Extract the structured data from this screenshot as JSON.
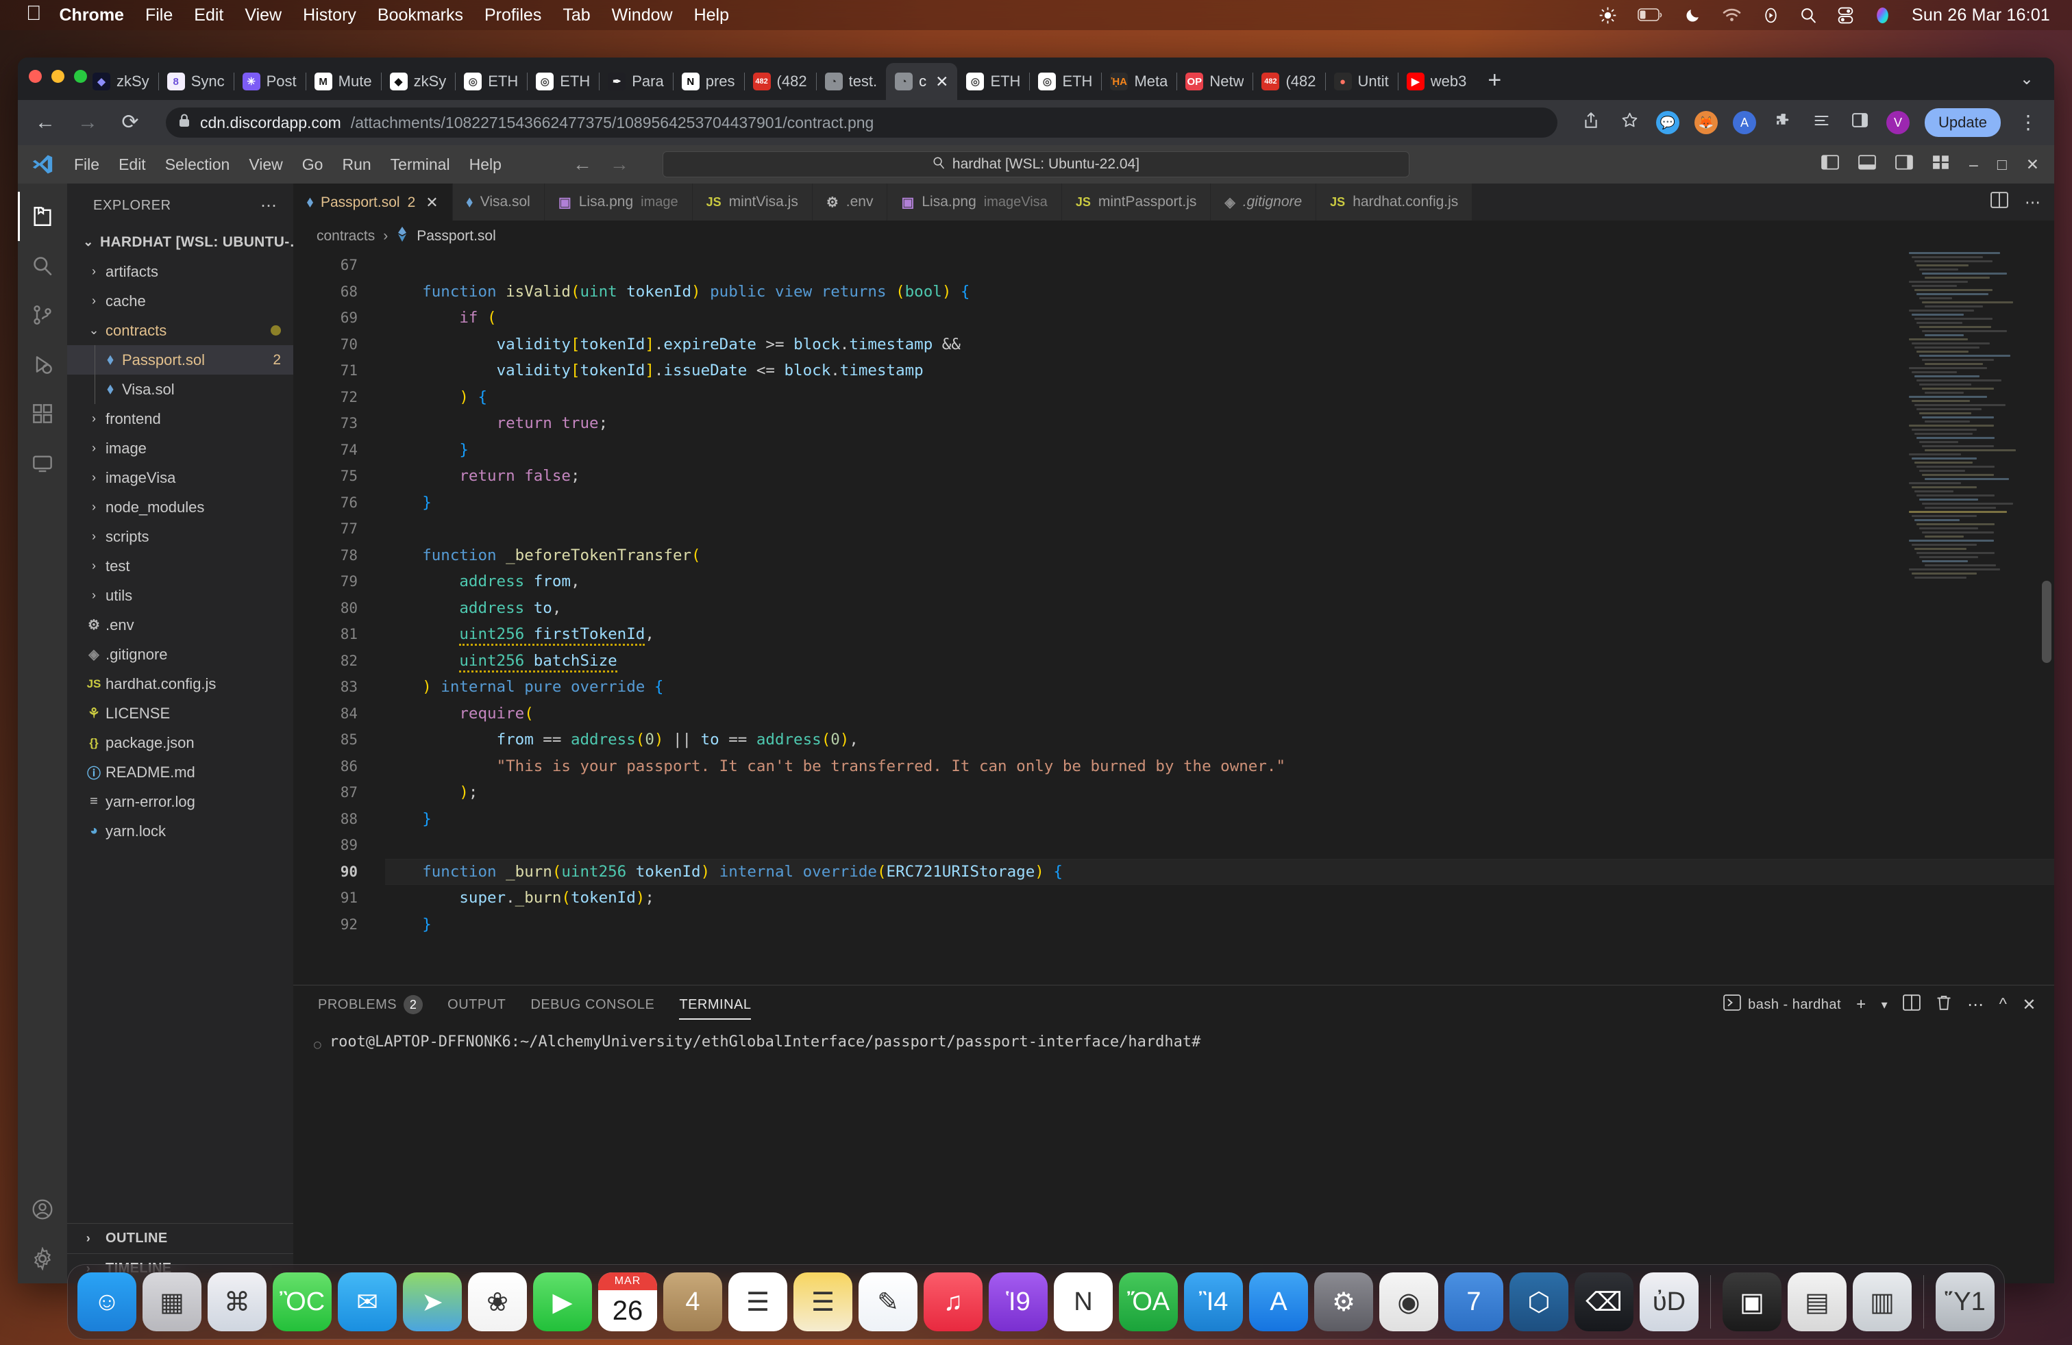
{
  "macos": {
    "apple_icon": "apple-logo",
    "menus": [
      {
        "label": "Chrome",
        "bold": true
      },
      {
        "label": "File",
        "bold": false
      },
      {
        "label": "Edit",
        "bold": false
      },
      {
        "label": "View",
        "bold": false
      },
      {
        "label": "History",
        "bold": false
      },
      {
        "label": "Bookmarks",
        "bold": false
      },
      {
        "label": "Profiles",
        "bold": false
      },
      {
        "label": "Tab",
        "bold": false
      },
      {
        "label": "Window",
        "bold": false
      },
      {
        "label": "Help",
        "bold": false
      }
    ],
    "status_icons": [
      "brightness-icon",
      "battery-icon",
      "moon-do-not-disturb-icon",
      "wifi-icon",
      "now-playing-icon",
      "spotlight-search-icon",
      "control-center-icon",
      "siri-icon"
    ],
    "clock": "Sun 26 Mar  16:01"
  },
  "chrome": {
    "tabs": [
      {
        "title": "zkSy",
        "favicon": "zksync-icon",
        "active": false
      },
      {
        "title": "Sync",
        "favicon": "sync-icon",
        "active": false
      },
      {
        "title": "Post",
        "favicon": "post-icon",
        "active": false
      },
      {
        "title": "Mute",
        "favicon": "mute-icon",
        "active": false
      },
      {
        "title": "zkSy",
        "favicon": "zksync-light-icon",
        "active": false
      },
      {
        "title": "ETH",
        "favicon": "ethglobal-icon",
        "active": false
      },
      {
        "title": "ETH",
        "favicon": "ethglobal-icon",
        "active": false
      },
      {
        "title": "Para",
        "favicon": "paragraph-icon",
        "active": false
      },
      {
        "title": "pres",
        "favicon": "notion-icon",
        "active": false
      },
      {
        "title": "(482",
        "favicon": "gmail-482-icon",
        "active": false
      },
      {
        "title": "test.",
        "favicon": "globe-icon",
        "active": false
      },
      {
        "title": "c",
        "favicon": "globe-icon",
        "active": true
      },
      {
        "title": "ETH",
        "favicon": "ethglobal-icon",
        "active": false
      },
      {
        "title": "ETH",
        "favicon": "ethglobal-icon",
        "active": false
      },
      {
        "title": "Meta",
        "favicon": "metamask-icon",
        "active": false
      },
      {
        "title": "Netw",
        "favicon": "optimism-icon",
        "active": false
      },
      {
        "title": "(482",
        "favicon": "gmail-482-icon",
        "active": false
      },
      {
        "title": "Untit",
        "favicon": "figma-icon",
        "active": false
      },
      {
        "title": "web3",
        "favicon": "youtube-icon",
        "active": false
      }
    ],
    "new_tab_label": "+",
    "tab_list_chevron": "⌄",
    "toolbar": {
      "back": "←",
      "forward": "→",
      "reload": "⟳",
      "lock_icon": "lock-icon",
      "url_host": "cdn.discordapp.com",
      "url_path": "/attachments/1082271543662477375/1089564253704437901/contract.png",
      "share_icon": "share-icon",
      "bookmark_icon": "star-icon",
      "extensions": [
        "chat-extension-icon",
        "metamask-extension-icon",
        "aleph-extension-icon",
        "puzzle-extension-icon",
        "reading-list-icon",
        "sidepanel-icon"
      ],
      "profile_initial": "V",
      "update_label": "Update",
      "menu_icon": "kebab-menu-icon"
    }
  },
  "vscode": {
    "titlebar": {
      "logo": "vscode-logo",
      "menus": [
        "File",
        "Edit",
        "Selection",
        "View",
        "Go",
        "Run",
        "Terminal",
        "Help"
      ],
      "back_arrow": "←",
      "forward_arrow": "→",
      "search_icon": "magnifier-icon",
      "search_text": "hardhat [WSL: Ubuntu-22.04]",
      "right_icons": [
        "toggle-primary-sidebar-icon",
        "toggle-panel-icon",
        "toggle-secondary-sidebar-icon",
        "customize-layout-icon"
      ],
      "window_controls": [
        "minimize",
        "maximize",
        "close"
      ]
    },
    "activitybar": [
      {
        "name": "explorer",
        "icon": "files-icon",
        "active": true
      },
      {
        "name": "search",
        "icon": "search-icon",
        "active": false
      },
      {
        "name": "source-control",
        "icon": "source-control-icon",
        "active": false
      },
      {
        "name": "run-and-debug",
        "icon": "debug-icon",
        "active": false
      },
      {
        "name": "extensions",
        "icon": "extensions-icon",
        "active": false
      },
      {
        "name": "remote-explorer",
        "icon": "remote-icon",
        "active": false
      },
      {
        "name": "accounts",
        "icon": "account-icon",
        "active": false
      },
      {
        "name": "settings",
        "icon": "gear-icon",
        "active": false
      }
    ],
    "explorer": {
      "header": "EXPLORER",
      "more_actions": "⋯",
      "root": "HARDHAT [WSL: UBUNTU-…",
      "tree": [
        {
          "label": "artifacts",
          "type": "folder",
          "expanded": false,
          "indent": 1
        },
        {
          "label": "cache",
          "type": "folder",
          "expanded": false,
          "indent": 1
        },
        {
          "label": "contracts",
          "type": "folder",
          "expanded": true,
          "indent": 1,
          "modified": true,
          "dot": true
        },
        {
          "label": "Passport.sol",
          "type": "solidity",
          "indent": 2,
          "selected": true,
          "modified": true,
          "count": "2"
        },
        {
          "label": "Visa.sol",
          "type": "solidity",
          "indent": 2
        },
        {
          "label": "frontend",
          "type": "folder",
          "expanded": false,
          "indent": 1
        },
        {
          "label": "image",
          "type": "folder",
          "expanded": false,
          "indent": 1
        },
        {
          "label": "imageVisa",
          "type": "folder",
          "expanded": false,
          "indent": 1
        },
        {
          "label": "node_modules",
          "type": "folder",
          "expanded": false,
          "indent": 1
        },
        {
          "label": "scripts",
          "type": "folder",
          "expanded": false,
          "indent": 1
        },
        {
          "label": "test",
          "type": "folder",
          "expanded": false,
          "indent": 1
        },
        {
          "label": "utils",
          "type": "folder",
          "expanded": false,
          "indent": 1
        },
        {
          "label": ".env",
          "type": "env",
          "indent": 1
        },
        {
          "label": ".gitignore",
          "type": "git",
          "indent": 1
        },
        {
          "label": "hardhat.config.js",
          "type": "js",
          "indent": 1
        },
        {
          "label": "LICENSE",
          "type": "license",
          "indent": 1
        },
        {
          "label": "package.json",
          "type": "json",
          "indent": 1
        },
        {
          "label": "README.md",
          "type": "readme",
          "indent": 1
        },
        {
          "label": "yarn-error.log",
          "type": "log",
          "indent": 1
        },
        {
          "label": "yarn.lock",
          "type": "yarn",
          "indent": 1
        }
      ],
      "outline": "OUTLINE",
      "timeline": "TIMELINE"
    },
    "editor_tabs": [
      {
        "label": "Passport.sol",
        "icon": "solidity-icon",
        "count": "2",
        "active": true,
        "closable": true
      },
      {
        "label": "Visa.sol",
        "icon": "solidity-icon",
        "active": false
      },
      {
        "label": "Lisa.png",
        "sub": "image",
        "icon": "image-icon",
        "active": false
      },
      {
        "label": "mintVisa.js",
        "icon": "js-icon",
        "active": false
      },
      {
        "label": ".env",
        "icon": "gear-icon",
        "active": false
      },
      {
        "label": "Lisa.png",
        "sub": "imageVisa",
        "icon": "image-icon",
        "active": false
      },
      {
        "label": "mintPassport.js",
        "icon": "js-icon",
        "active": false
      },
      {
        "label": ".gitignore",
        "icon": "git-icon",
        "italic": true,
        "active": false
      },
      {
        "label": "hardhat.config.js",
        "icon": "js-icon",
        "active": false
      }
    ],
    "editor_tabs_right": [
      "split-editor-icon",
      "more-actions-icon"
    ],
    "breadcrumb": [
      "contracts",
      "Passport.sol"
    ],
    "breadcrumb_separator": "›",
    "code": {
      "first_line": 67,
      "current_line": 90,
      "lines": [
        {
          "n": 67,
          "text": ""
        },
        {
          "n": 68,
          "text": "    function isValid(uint tokenId) public view returns (bool) {"
        },
        {
          "n": 69,
          "text": "        if ("
        },
        {
          "n": 70,
          "text": "            validity[tokenId].expireDate >= block.timestamp &&"
        },
        {
          "n": 71,
          "text": "            validity[tokenId].issueDate <= block.timestamp"
        },
        {
          "n": 72,
          "text": "        ) {"
        },
        {
          "n": 73,
          "text": "            return true;"
        },
        {
          "n": 74,
          "text": "        }"
        },
        {
          "n": 75,
          "text": "        return false;"
        },
        {
          "n": 76,
          "text": "    }"
        },
        {
          "n": 77,
          "text": ""
        },
        {
          "n": 78,
          "text": "    function _beforeTokenTransfer("
        },
        {
          "n": 79,
          "text": "        address from,"
        },
        {
          "n": 80,
          "text": "        address to,"
        },
        {
          "n": 81,
          "text": "        uint256 firstTokenId,"
        },
        {
          "n": 82,
          "text": "        uint256 batchSize"
        },
        {
          "n": 83,
          "text": "    ) internal pure override {"
        },
        {
          "n": 84,
          "text": "        require("
        },
        {
          "n": 85,
          "text": "            from == address(0) || to == address(0),"
        },
        {
          "n": 86,
          "text": "            \"This is your passport. It can't be transferred. It can only be burned by the owner.\""
        },
        {
          "n": 87,
          "text": "        );"
        },
        {
          "n": 88,
          "text": "    }"
        },
        {
          "n": 89,
          "text": ""
        },
        {
          "n": 90,
          "text": "    function _burn(uint256 tokenId) internal override(ERC721URIStorage) {"
        },
        {
          "n": 91,
          "text": "        super._burn(tokenId);"
        },
        {
          "n": 92,
          "text": "    }"
        }
      ]
    },
    "panel": {
      "tabs": [
        {
          "label": "PROBLEMS",
          "badge": "2",
          "active": false
        },
        {
          "label": "OUTPUT",
          "active": false
        },
        {
          "label": "DEBUG CONSOLE",
          "active": false
        },
        {
          "label": "TERMINAL",
          "active": true
        }
      ],
      "terminal_name": "bash - hardhat",
      "terminal_icon": "terminal-icon",
      "actions": [
        "new-terminal-icon",
        "terminal-dropdown-icon",
        "split-terminal-icon",
        "kill-terminal-icon",
        "panel-more-icon",
        "maximize-panel-icon",
        "close-panel-icon"
      ],
      "prompt": "root@LAPTOP-DFFNONK6:~/AlchemyUniversity/ethGlobalInterface/passport/passport-interface/hardhat#"
    }
  },
  "dock": {
    "items": [
      {
        "name": "finder",
        "running": true
      },
      {
        "name": "launchpad",
        "running": false
      },
      {
        "name": "safari",
        "running": true
      },
      {
        "name": "messages",
        "running": false
      },
      {
        "name": "mail",
        "running": false
      },
      {
        "name": "maps",
        "running": false
      },
      {
        "name": "photos",
        "running": false
      },
      {
        "name": "facetime",
        "running": false
      },
      {
        "name": "calendar",
        "running": true,
        "month": "MAR",
        "day": "26"
      },
      {
        "name": "contacts",
        "running": false
      },
      {
        "name": "reminders",
        "running": false
      },
      {
        "name": "notes",
        "running": false
      },
      {
        "name": "freeform",
        "running": false
      },
      {
        "name": "music",
        "running": true
      },
      {
        "name": "podcasts",
        "running": false
      },
      {
        "name": "news",
        "running": false
      },
      {
        "name": "numbers",
        "running": false
      },
      {
        "name": "keynote",
        "running": false
      },
      {
        "name": "appstore",
        "running": false
      },
      {
        "name": "system-settings",
        "running": false
      },
      {
        "name": "chrome",
        "running": true
      },
      {
        "name": "zoom",
        "running": true
      },
      {
        "name": "vscode",
        "running": true
      },
      {
        "name": "terminal",
        "running": true
      },
      {
        "name": "preview",
        "running": true
      },
      {
        "name": "screenshot-1",
        "running": false
      },
      {
        "name": "screenshot-2",
        "running": false
      },
      {
        "name": "screenshot-3",
        "running": false
      },
      {
        "name": "trash",
        "running": false
      }
    ]
  },
  "colors": {
    "accent_blue": "#8ab4f8",
    "vscode_bg": "#1e1e1e",
    "vscode_sidebar": "#252526",
    "modified_yellow": "#e2c08d",
    "chrome_bg": "#202124"
  }
}
